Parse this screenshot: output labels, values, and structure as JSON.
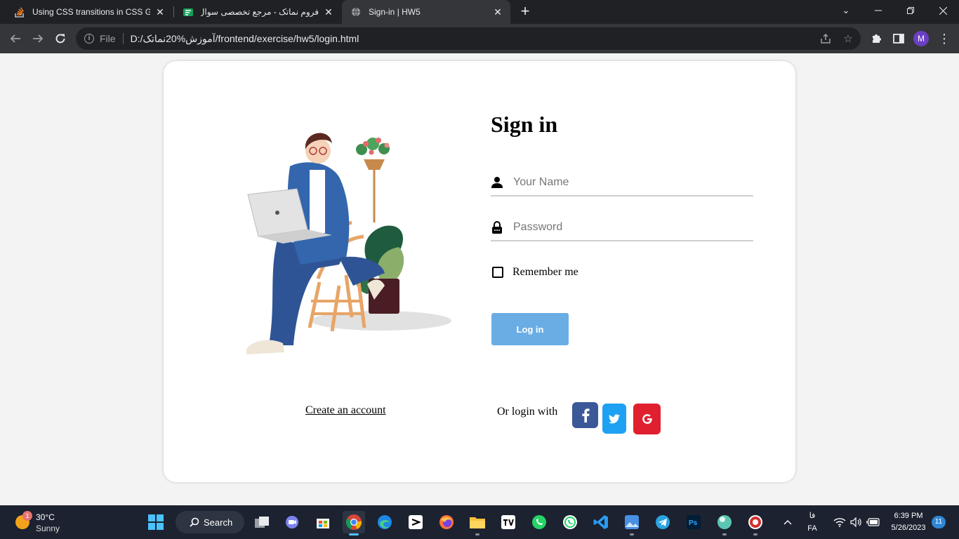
{
  "browser": {
    "tabs": [
      {
        "title": "Using CSS transitions in CSS Grid",
        "active": false
      },
      {
        "title": "فروم نماتک - مرجع تخصصی سوال",
        "active": false
      },
      {
        "title": "Sign-in | HW5",
        "active": true
      }
    ],
    "omnibox": {
      "scheme_label": "File",
      "url": "D:/آموزش%20نماتک/frontend/exercise/hw5/login.html"
    },
    "profile_initial": "M"
  },
  "page": {
    "title": "Sign in",
    "name_placeholder": "Your Name",
    "password_placeholder": "Password",
    "remember_label": "Remember me",
    "login_button": "Log in",
    "create_account": "Create an account",
    "or_login_with": "Or login with",
    "social": [
      {
        "name": "facebook",
        "glyph": "f",
        "color": "#3b5998"
      },
      {
        "name": "twitter",
        "glyph": "t",
        "color": "#1da1f2"
      },
      {
        "name": "google",
        "glyph": "G",
        "color": "#e0202f"
      }
    ],
    "accent_color": "#6aade4"
  },
  "taskbar": {
    "weather": {
      "temp": "30°C",
      "condition": "Sunny",
      "badge": "1"
    },
    "search_label": "Search",
    "language": {
      "script": "فا",
      "code": "FA"
    },
    "clock": {
      "time": "6:39 PM",
      "date": "5/26/2023"
    },
    "notifications": "11"
  }
}
